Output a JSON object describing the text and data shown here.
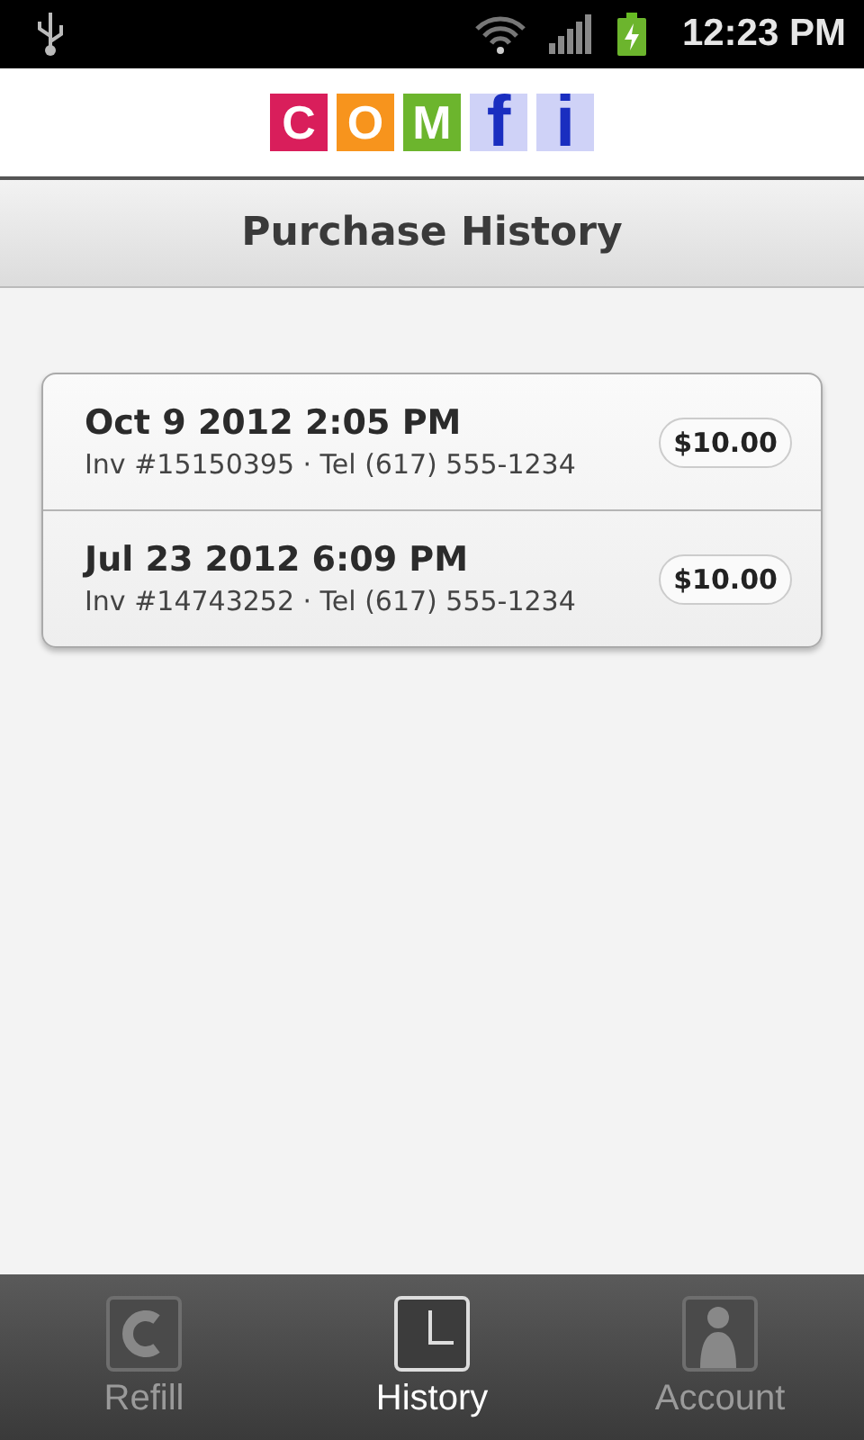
{
  "status_bar": {
    "time": "12:23 PM"
  },
  "logo": {
    "letters": [
      {
        "char": "C",
        "color": "#d91e5b",
        "kind": "tile"
      },
      {
        "char": "O",
        "color": "#f7941d",
        "kind": "tile"
      },
      {
        "char": "M",
        "color": "#6cb52d",
        "kind": "tile"
      },
      {
        "char": "f",
        "color": "#cfd2f7",
        "kind": "tall"
      },
      {
        "char": "i",
        "color": "#cfd2f7",
        "kind": "tall"
      }
    ]
  },
  "title": "Purchase History",
  "purchases": [
    {
      "date": "Oct 9 2012 2:05 PM",
      "details": "Inv #15150395 · Tel (617) 555-1234",
      "amount": "$10.00"
    },
    {
      "date": "Jul 23 2012 6:09 PM",
      "details": "Inv #14743252 · Tel (617) 555-1234",
      "amount": "$10.00"
    }
  ],
  "tabs": [
    {
      "label": "Refill",
      "kind": "refill",
      "selected": false
    },
    {
      "label": "History",
      "kind": "history",
      "selected": true
    },
    {
      "label": "Account",
      "kind": "account",
      "selected": false
    }
  ]
}
